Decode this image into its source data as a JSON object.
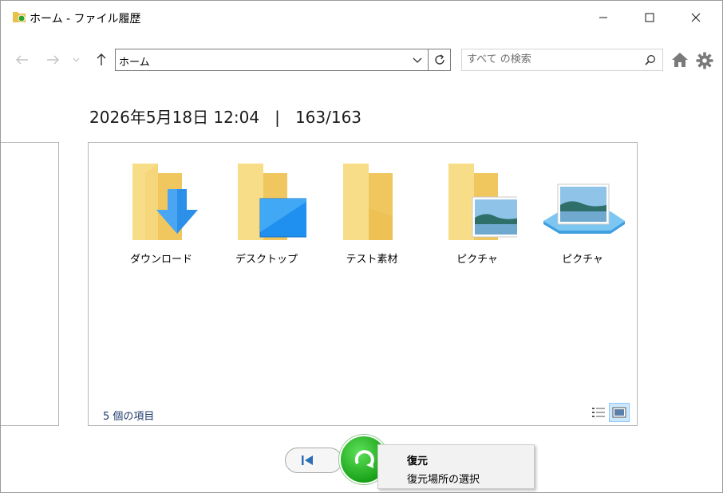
{
  "window": {
    "title": "ホーム - ファイル履歴"
  },
  "nav": {
    "address": "ホーム",
    "search_placeholder": "すべて の検索"
  },
  "snapshot": {
    "header": "2026年5月18日 12:04   |   163/163"
  },
  "items": [
    {
      "label": "ダウンロード",
      "icon": "downloads-folder-icon"
    },
    {
      "label": "デスクトップ",
      "icon": "desktop-folder-icon"
    },
    {
      "label": "テスト素材",
      "icon": "folder-icon"
    },
    {
      "label": "ピクチャ",
      "icon": "pictures-folder-icon"
    },
    {
      "label": "ピクチャ",
      "icon": "pictures-library-icon"
    }
  ],
  "status": {
    "count": "5 個の項目"
  },
  "context_menu": {
    "items": [
      {
        "label": "復元"
      },
      {
        "label": "復元場所の選択"
      }
    ]
  },
  "colors": {
    "folder": "#f7d66d",
    "accent_blue": "#1e90ff",
    "restore_green": "#1aa318"
  }
}
